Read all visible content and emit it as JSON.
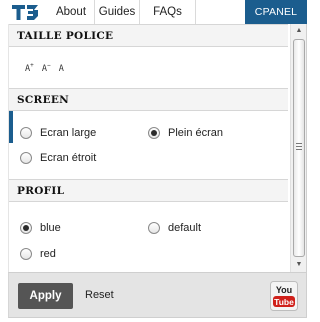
{
  "nav": {
    "about": "About",
    "guides": "Guides",
    "faqs": "FAQs",
    "cpanel": "CPANEL"
  },
  "sections": {
    "font_size": {
      "title": "TAILLE POLICE",
      "options": [
        "A+",
        "A-",
        "A"
      ]
    },
    "screen": {
      "title": "SCREEN",
      "options": [
        {
          "label": "Ecran large",
          "checked": false
        },
        {
          "label": "Plein écran",
          "checked": true
        },
        {
          "label": "Ecran étroit",
          "checked": false
        }
      ]
    },
    "profil": {
      "title": "PROFIL",
      "options": [
        {
          "label": "blue",
          "checked": true
        },
        {
          "label": "default",
          "checked": false
        },
        {
          "label": "red",
          "checked": false
        }
      ]
    }
  },
  "footer": {
    "apply": "Apply",
    "reset": "Reset",
    "youtube_icon": "youtube-icon"
  },
  "colors": {
    "accent": "#1b5d8e",
    "apply_bg": "#555555",
    "footer_bg": "#e4e4e4",
    "youtube_red": "#d0211b"
  }
}
